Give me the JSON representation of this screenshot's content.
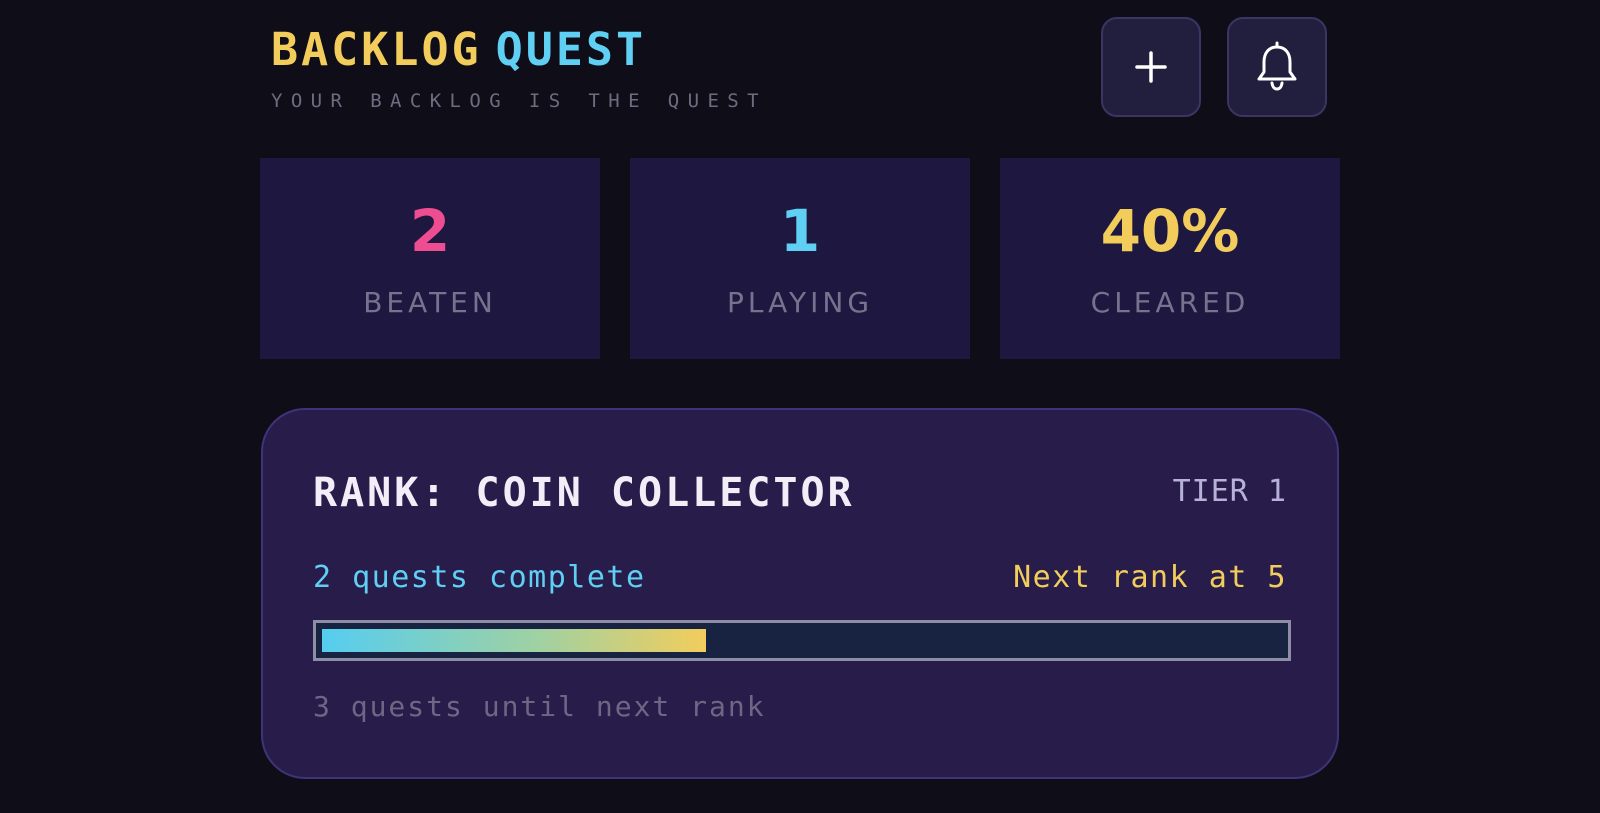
{
  "header": {
    "title_word1": "BACKLOG",
    "title_word2": "QUEST",
    "tagline": "YOUR BACKLOG IS THE QUEST",
    "add_button_icon": "plus-icon",
    "notifications_button_icon": "bell-icon"
  },
  "stats": [
    {
      "value": "2",
      "label": "BEATEN",
      "color": "#ee4d92"
    },
    {
      "value": "1",
      "label": "PLAYING",
      "color": "#5fd0f3"
    },
    {
      "value": "40%",
      "label": "CLEARED",
      "color": "#f2cd5c"
    }
  ],
  "rank": {
    "title": "RANK: COIN COLLECTOR",
    "tier": "TIER 1",
    "progress_text": "2 quests complete",
    "next_text": "Next rank at 5",
    "progress_fraction": 0.4,
    "remaining_text": "3 quests until next rank"
  },
  "colors": {
    "background": "#0e0d18",
    "accent_yellow": "#f2cd5c",
    "accent_cyan": "#5fd0f3",
    "accent_pink": "#ee4d92",
    "card": "#271c4a"
  }
}
